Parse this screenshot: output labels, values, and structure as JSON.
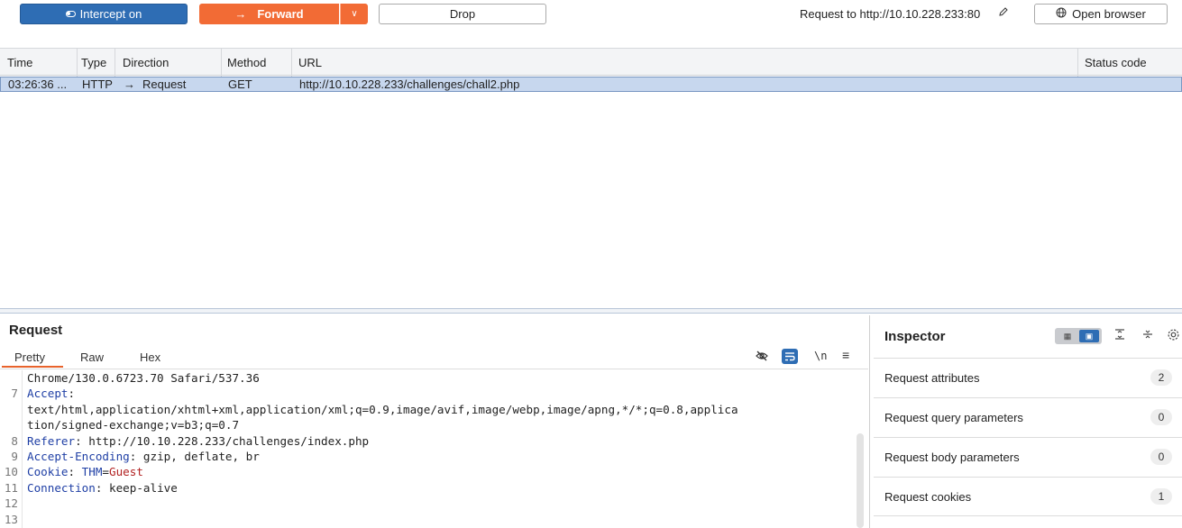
{
  "toolbar": {
    "intercept_label": "Intercept on",
    "forward_label": "Forward",
    "drop_label": "Drop",
    "request_to": "Request to http://10.10.228.233:80",
    "open_browser_label": "Open browser"
  },
  "table": {
    "headers": [
      "Time",
      "Type",
      "Direction",
      "Method",
      "URL",
      "Status code"
    ],
    "rows": [
      {
        "time": "03:26:36 ...",
        "type": "HTTP",
        "direction": "Request",
        "method": "GET",
        "url": "http://10.10.228.233/challenges/chall2.php",
        "status": ""
      }
    ]
  },
  "request": {
    "title": "Request",
    "tabs": [
      "Pretty",
      "Raw",
      "Hex"
    ],
    "active_tab": "Pretty",
    "lines": [
      {
        "num": "",
        "text": "Chrome/130.0.6723.70 Safari/537.36"
      },
      {
        "num": "7",
        "key": "Accept",
        "value": ""
      },
      {
        "num": "",
        "text": "text/html,application/xhtml+xml,application/xml;q=0.9,image/avif,image/webp,image/apng,*/*;q=0.8,applica"
      },
      {
        "num": "",
        "text": "tion/signed-exchange;v=b3;q=0.7"
      },
      {
        "num": "8",
        "key": "Referer",
        "value": " http://10.10.228.233/challenges/index.php"
      },
      {
        "num": "9",
        "key": "Accept-Encoding",
        "value": " gzip, deflate, br"
      },
      {
        "num": "10",
        "key": "Cookie",
        "cookie_name": "THM",
        "cookie_value": "Guest"
      },
      {
        "num": "11",
        "key": "Connection",
        "value": " keep-alive"
      },
      {
        "num": "12",
        "text": ""
      },
      {
        "num": "13",
        "text": ""
      }
    ]
  },
  "inspector": {
    "title": "Inspector",
    "items": [
      {
        "label": "Request attributes",
        "count": "2"
      },
      {
        "label": "Request query parameters",
        "count": "0"
      },
      {
        "label": "Request body parameters",
        "count": "0"
      },
      {
        "label": "Request cookies",
        "count": "1"
      }
    ]
  },
  "colors": {
    "intercept_blue": "#2e6db4",
    "forward_orange": "#f26b35",
    "selected_row": "#c7d7ee"
  }
}
